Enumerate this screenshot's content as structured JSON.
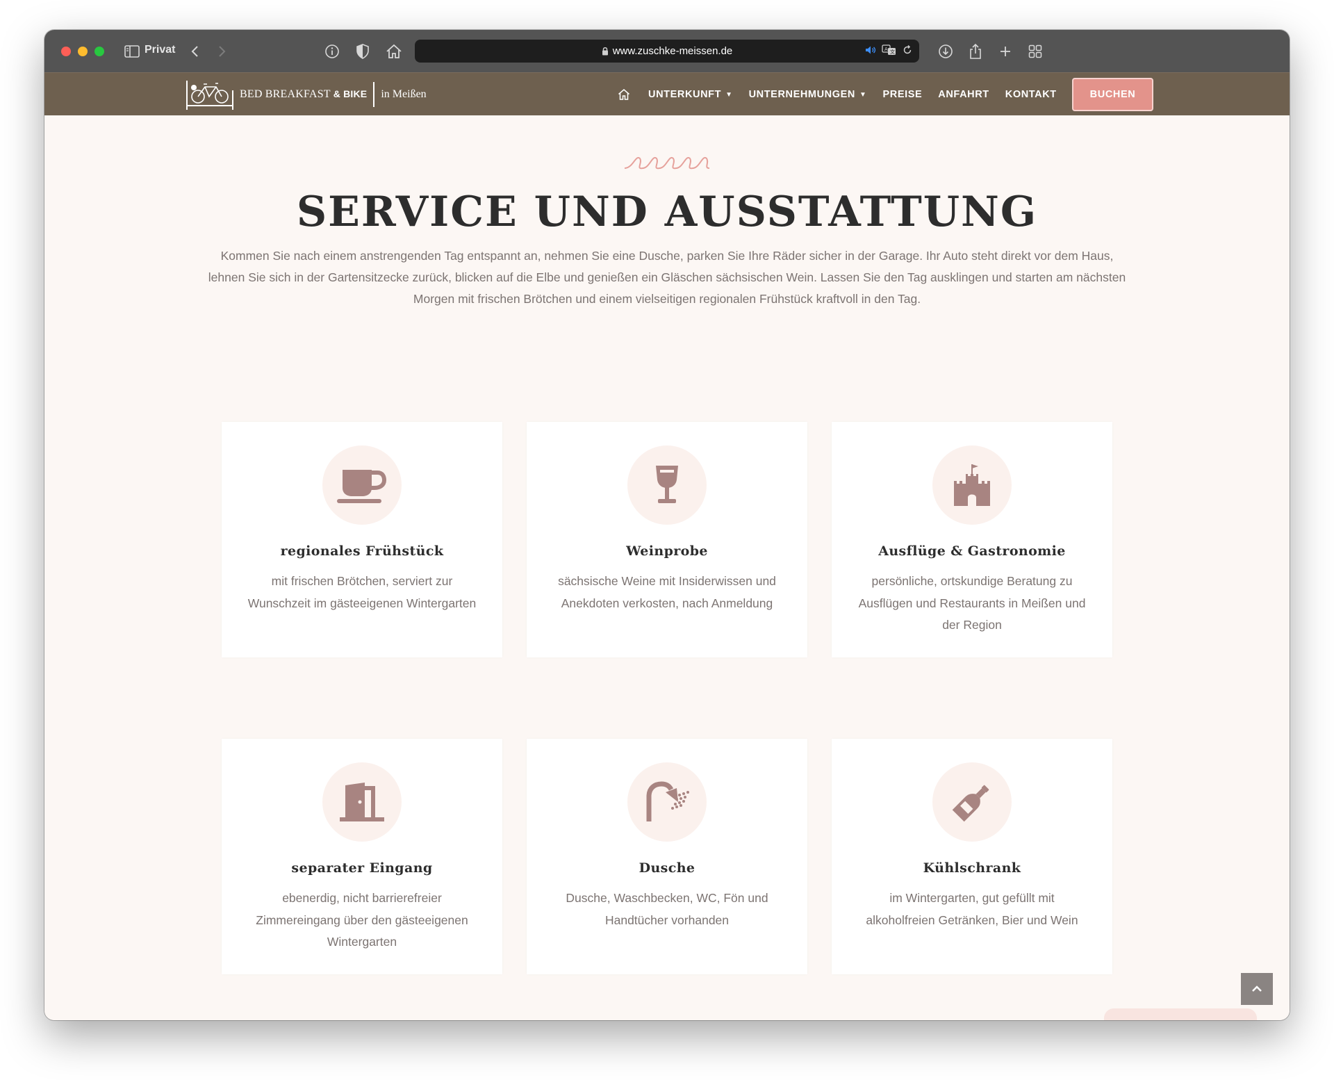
{
  "browser": {
    "mode_label": "Privat",
    "url": "www.zuschke-meissen.de"
  },
  "site": {
    "logo": {
      "brand_bed_breakfast": "BED BREAKFAST",
      "brand_bike": "& BIKE",
      "city": "in Meißen"
    },
    "nav": {
      "items": [
        "UNTERKUNFT",
        "UNTERNEHMUNGEN",
        "PREISE",
        "ANFAHRT",
        "KONTAKT"
      ],
      "book_button": "BUCHEN"
    }
  },
  "section": {
    "title": "SERVICE UND AUSSTATTUNG",
    "intro": "Kommen Sie nach einem anstrengenden Tag entspannt an, nehmen Sie eine Dusche, parken Sie Ihre Räder sicher in der Garage. Ihr Auto steht direkt vor dem Haus, lehnen Sie sich in der Gartensitzecke zurück, blicken auf die Elbe und genießen ein Gläschen sächsischen Wein. Lassen Sie den Tag ausklingen und starten am nächsten Morgen mit frischen Brötchen und einem vielseitigen regionalen Frühstück kraftvoll in den Tag."
  },
  "features": [
    {
      "icon": "coffee-cup-icon",
      "title": "regionales Frühstück",
      "desc": "mit frischen Brötchen, serviert zur Wunschzeit im gästeeigenen Wintergarten"
    },
    {
      "icon": "wine-glass-icon",
      "title": "Weinprobe",
      "desc": "sächsische Weine mit Insiderwissen und Anekdoten verkosten, nach Anmeldung"
    },
    {
      "icon": "castle-icon",
      "title": "Ausflüge & Gastronomie",
      "desc": "persönliche, ortskundige Beratung zu Ausflügen und Restaurants in Meißen und der Region"
    },
    {
      "icon": "door-icon",
      "title": "separater Eingang",
      "desc": "ebenerdig, nicht barrierefreier Zimmereingang über den gästeeigenen Wintergarten"
    },
    {
      "icon": "shower-icon",
      "title": "Dusche",
      "desc": "Dusche, Waschbecken, WC, Fön und Handtücher vorhanden"
    },
    {
      "icon": "bottle-icon",
      "title": "Kühlschrank",
      "desc": "im Wintergarten, gut gefüllt mit alkoholfreien Getränken, Bier und Wein"
    }
  ],
  "colors": {
    "nav_bg": "#6e604f",
    "accent_pink": "#e3938b",
    "icon_color": "#a88481",
    "page_bg": "#fcf7f4"
  }
}
